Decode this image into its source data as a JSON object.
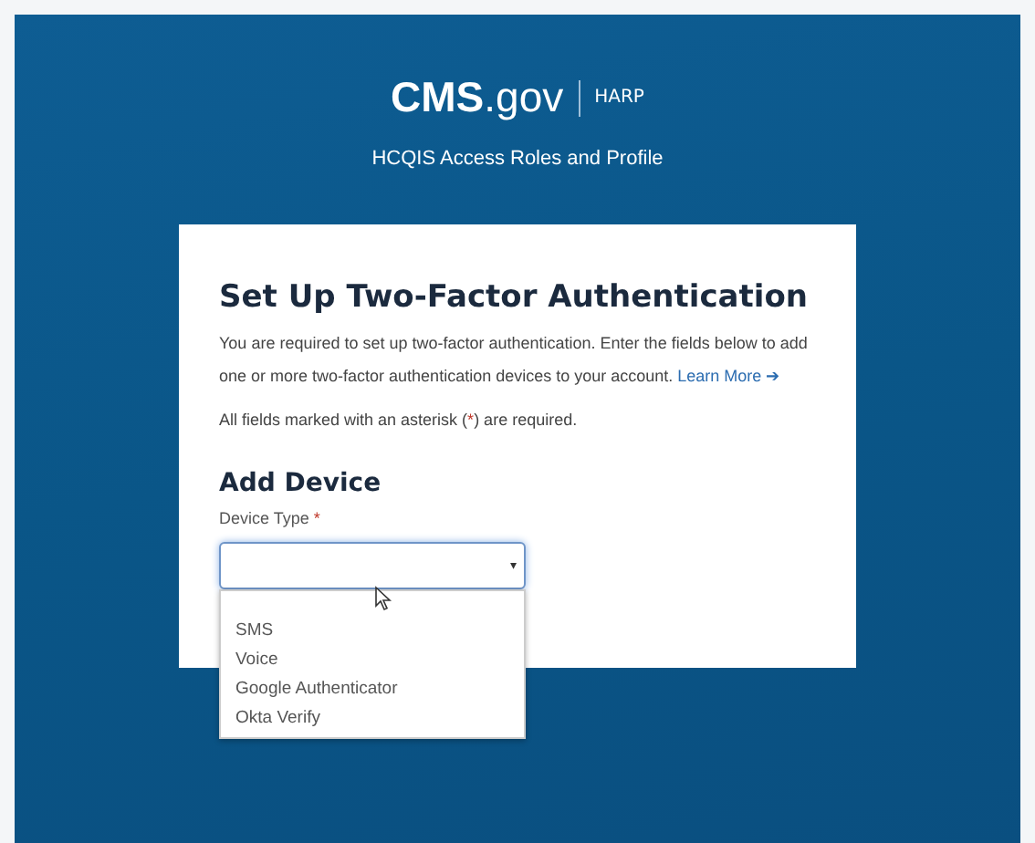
{
  "header": {
    "logo": "**CMS**.gov",
    "product": "HARP",
    "subtitle": "HCQIS Access Roles and Profile"
  },
  "card": {
    "title": "Set Up Two-Factor Authentication",
    "intro": "You are required to set up two-factor authentication. Enter the fields below to add one or more two-factor authentication devices to your account.",
    "learn_more": "Learn More",
    "learn_more_arrow": "➔",
    "note": [
      "All fields marked with an asterisk (",
      "*",
      ") are required."
    ],
    "section_title": "Add Device",
    "field": {
      "label": "Device Type",
      "required_mark": "*",
      "expanded": true,
      "caret": "▾",
      "options": [
        {
          "label": "SMS"
        },
        {
          "label": "Voice"
        },
        {
          "label": "Google Authenticator"
        },
        {
          "label": "Okta Verify"
        }
      ]
    }
  }
}
